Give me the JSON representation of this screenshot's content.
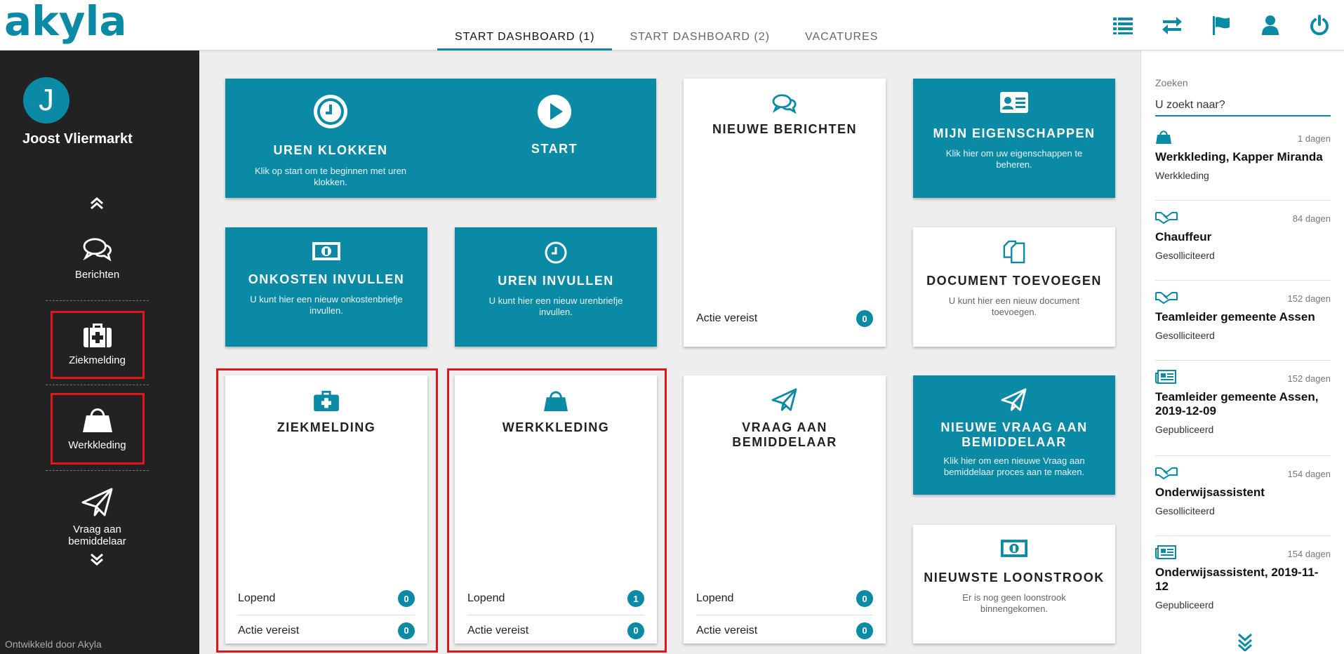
{
  "brand": {
    "logo_text": "akyla",
    "accent": "#0b8aa6",
    "highlight": "#e0161b"
  },
  "tabs": [
    {
      "label": "START DASHBOARD (1)",
      "active": true
    },
    {
      "label": "START DASHBOARD (2)",
      "active": false
    },
    {
      "label": "VACATURES",
      "active": false
    }
  ],
  "top_icons": [
    "list-icon",
    "swap-icon",
    "flag-icon",
    "user-icon",
    "power-icon"
  ],
  "sidebar": {
    "avatar_letter": "J",
    "user_name": "Joost Vliermarkt",
    "items": [
      {
        "label": "Berichten",
        "icon": "chat-icon"
      },
      {
        "label": "Ziekmelding",
        "icon": "medkit-icon"
      },
      {
        "label": "Werkkleding",
        "icon": "shopping-bag-icon"
      },
      {
        "label": "Vraag aan bemiddelaar",
        "icon": "paper-plane-icon"
      }
    ],
    "footer": "Ontwikkeld door Akyla"
  },
  "tiles": {
    "uren_klokken": {
      "title": "UREN KLOKKEN",
      "desc": "Klik op start om te beginnen met uren klokken.",
      "start_label": "START"
    },
    "nieuwe_berichten": {
      "title": "NIEUWE BERICHTEN",
      "row_label": "Actie vereist",
      "row_count": "0"
    },
    "mijn_eigenschappen": {
      "title": "MIJN EIGENSCHAPPEN",
      "desc": "Klik hier om uw eigenschappen te beheren."
    },
    "onkosten": {
      "title": "ONKOSTEN INVULLEN",
      "desc": "U kunt hier een nieuw onkostenbriefje invullen."
    },
    "uren_invullen": {
      "title": "UREN INVULLEN",
      "desc": "U kunt hier een nieuw urenbriefje invullen."
    },
    "document": {
      "title": "DOCUMENT TOEVOEGEN",
      "desc": "U kunt hier een nieuw document toevoegen."
    },
    "ziekmelding": {
      "title": "ZIEKMELDING",
      "row1_label": "Lopend",
      "row1_count": "0",
      "row2_label": "Actie vereist",
      "row2_count": "0"
    },
    "werkkleding": {
      "title": "WERKKLEDING",
      "row1_label": "Lopend",
      "row1_count": "1",
      "row2_label": "Actie vereist",
      "row2_count": "0"
    },
    "vraag": {
      "title": "VRAAG AAN BEMIDDELAAR",
      "row1_label": "Lopend",
      "row1_count": "0",
      "row2_label": "Actie vereist",
      "row2_count": "0"
    },
    "nieuwe_vraag": {
      "title": "NIEUWE VRAAG AAN BEMIDDELAAR",
      "desc": "Klik hier om een nieuwe Vraag aan bemiddelaar proces aan te maken."
    },
    "loonstrook": {
      "title": "NIEUWSTE LOONSTROOK",
      "desc": "Er is nog geen loonstrook binnengekomen."
    }
  },
  "search": {
    "label": "Zoeken",
    "placeholder": "U zoekt naar?"
  },
  "feed": [
    {
      "icon": "shopping-bag-icon",
      "days": "1 dagen",
      "title": "Werkkleding, Kapper Miranda",
      "subtitle": "Werkkleding"
    },
    {
      "icon": "handshake-icon",
      "days": "84 dagen",
      "title": "Chauffeur",
      "subtitle": "Gesolliciteerd"
    },
    {
      "icon": "handshake-icon",
      "days": "152 dagen",
      "title": "Teamleider gemeente Assen",
      "subtitle": "Gesolliciteerd"
    },
    {
      "icon": "newspaper-icon",
      "days": "152 dagen",
      "title": "Teamleider gemeente Assen, 2019-12-09",
      "subtitle": "Gepubliceerd"
    },
    {
      "icon": "handshake-icon",
      "days": "154 dagen",
      "title": "Onderwijsassistent",
      "subtitle": "Gesolliciteerd"
    },
    {
      "icon": "newspaper-icon",
      "days": "154 dagen",
      "title": "Onderwijsassistent, 2019-11-12",
      "subtitle": "Gepubliceerd"
    }
  ]
}
